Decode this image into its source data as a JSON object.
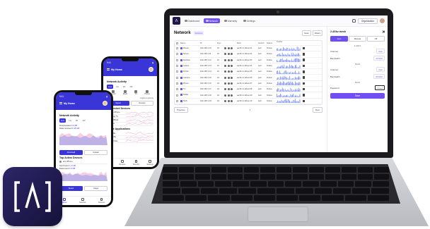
{
  "laptop": {
    "nav": {
      "tabs": [
        {
          "label": "Dashboard",
          "active": false
        },
        {
          "label": "Network",
          "active": true
        },
        {
          "label": "Warranty",
          "active": false
        },
        {
          "label": "Settings",
          "active": false
        }
      ],
      "org_select": "Organisation"
    },
    "page": {
      "title": "Network",
      "badge": "Devices",
      "tools": [
        "Scan",
        "Filters"
      ]
    },
    "table": {
      "headers": [
        "Name",
        "IP",
        "Port",
        "",
        "Vendor",
        "MAC",
        "Switch",
        "Status",
        "Traffic"
      ],
      "rows": [
        {
          "name": "Router",
          "ip": "192.168.1.10",
          "port": "24",
          "mac": "aa:bb:cc:dd:ee:01",
          "sw": "sw1",
          "st": "Online"
        },
        {
          "name": "Server",
          "ip": "192.168.1.11",
          "port": "24",
          "mac": "aa:bb:cc:dd:ee:02",
          "sw": "sw1",
          "st": "Online"
        },
        {
          "name": "Desktop",
          "ip": "192.168.1.12",
          "port": "24",
          "mac": "aa:bb:cc:dd:ee:03",
          "sw": "sw1",
          "st": "Online"
        },
        {
          "name": "Laptop",
          "ip": "192.168.1.13",
          "port": "24",
          "mac": "aa:bb:cc:dd:ee:04",
          "sw": "sw1",
          "st": "Online"
        },
        {
          "name": "Printer",
          "ip": "192.168.1.14",
          "port": "24",
          "mac": "aa:bb:cc:dd:ee:05",
          "sw": "sw1",
          "st": "Online"
        },
        {
          "name": "Camera",
          "ip": "192.168.1.15",
          "port": "24",
          "mac": "aa:bb:cc:dd:ee:06",
          "sw": "sw1",
          "st": "Online"
        },
        {
          "name": "Phone",
          "ip": "192.168.1.16",
          "port": "24",
          "mac": "aa:bb:cc:dd:ee:07",
          "sw": "sw1",
          "st": "Online"
        },
        {
          "name": "TV",
          "ip": "192.168.1.17",
          "port": "24",
          "mac": "aa:bb:cc:dd:ee:08",
          "sw": "sw1",
          "st": "Online"
        },
        {
          "name": "Tablet",
          "ip": "192.168.1.18",
          "port": "24",
          "mac": "aa:bb:cc:dd:ee:09",
          "sw": "sw1",
          "st": "Online"
        },
        {
          "name": "NAS",
          "ip": "192.168.1.19",
          "port": "24",
          "mac": "aa:bb:cc:dd:ee:10",
          "sw": "sw1",
          "st": "Online"
        }
      ]
    },
    "pager": {
      "prev": "Previous",
      "info": "1",
      "next": "Next"
    },
    "sidepanel": {
      "title": "2.4Ghz mesh",
      "segments": [
        "Auto",
        "Manual",
        "Off"
      ],
      "band1": "2.4Ghz",
      "rows1": [
        {
          "label": "Channel",
          "value": "Auto"
        },
        {
          "label": "Bandwidth",
          "value": "20 MHz"
        }
      ],
      "band2": "5Ghz",
      "rows2": [
        {
          "label": "Channel",
          "value": "Auto"
        },
        {
          "label": "Bandwidth",
          "value": "80 MHz"
        }
      ],
      "band3": "6Ghz",
      "input_label": "Password",
      "input_value": "••••••••",
      "save": "Save"
    }
  },
  "phone_back": {
    "status_time": "9:41",
    "home": "My Home",
    "section1": "Network Activity",
    "tabs": [
      "Live",
      "1H",
      "1D",
      "1W"
    ],
    "device_icons": [
      "Router",
      "Mesh",
      "TV",
      "Phone"
    ],
    "section2": "Connected Devices",
    "right_label": "Highest activity",
    "btns": [
      "Speed",
      "Devices"
    ],
    "list": [
      "eli's iPhone",
      "Living TV",
      "MacBook",
      "Echo"
    ],
    "section3": "Active Applications",
    "list2": [
      "Netflix",
      "Spotify",
      "YouTube"
    ],
    "bottom_nav": [
      "Home",
      "Devices",
      "Security",
      "Settings"
    ]
  },
  "phone_front": {
    "status_time": "9:41",
    "home": "My Home",
    "section1": "Network Activity",
    "tabs": [
      "Live",
      "1H",
      "1D",
      "1W"
    ],
    "stats": [
      {
        "label": "Downloaded",
        "value": "2.3 GB"
      },
      {
        "label": "Data received",
        "value": "1.08 GB"
      }
    ],
    "btns": [
      "Download",
      "Upload"
    ],
    "section2": "Top Active Devices",
    "device": "eli's iPhone",
    "device_stats": [
      {
        "label": "Sent bytes",
        "value": "1.2 GB"
      },
      {
        "label": "Data used",
        "value": "2.9 GB"
      }
    ],
    "btns2": [
      "Speed",
      "Usage"
    ],
    "bottom_nav": [
      "Home",
      "Network",
      "Devices"
    ]
  },
  "colors": {
    "accent": "#6f4ef2",
    "phone_accent": "#3a35d6",
    "chart_pink": "#f2a7c9",
    "chart_blue": "#7b8df0"
  },
  "icons": [
    "logo-icon",
    "bell-icon",
    "close-icon",
    "trash-icon",
    "menu-icon",
    "avatar-icon"
  ]
}
